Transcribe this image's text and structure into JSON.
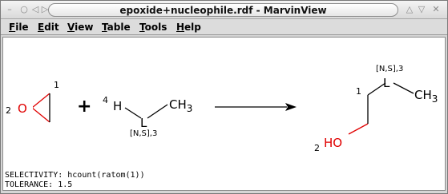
{
  "window": {
    "title": "epoxide+nucleophile.rdf - MarvinView",
    "controls": {
      "menu_glyph": "–",
      "close_glyph": "○",
      "minimize_glyph": "◁",
      "maximize_glyph": "▷",
      "shade_glyph": "△",
      "restore_glyph": "▽",
      "close_x_glyph": "✕"
    }
  },
  "menu": {
    "items": [
      {
        "label": "File"
      },
      {
        "label": "Edit"
      },
      {
        "label": "View"
      },
      {
        "label": "Table"
      },
      {
        "label": "Tools"
      },
      {
        "label": "Help"
      }
    ]
  },
  "reaction": {
    "plus_sign": "+",
    "reactant1": {
      "atom_O": "O",
      "map_1": "1",
      "map_2": "2"
    },
    "reactant2": {
      "atom_H": "H",
      "atom_L": "L",
      "atom_CH3": "CH",
      "ch3_sub": "3",
      "map_4": "4",
      "query_label": "[N,S],3"
    },
    "product": {
      "atom_HO": "HO",
      "atom_L": "L",
      "atom_CH3": "CH",
      "ch3_sub": "3",
      "map_1": "1",
      "map_2": "2",
      "query_label": "[N,S],3"
    }
  },
  "info": {
    "selectivity": "SELECTIVITY: hcount(ratom(1))",
    "tolerance": "TOLERANCE: 1.5"
  },
  "colors": {
    "oxygen": "#e00000",
    "bond": "#000000",
    "canvas": "#ffffff"
  }
}
